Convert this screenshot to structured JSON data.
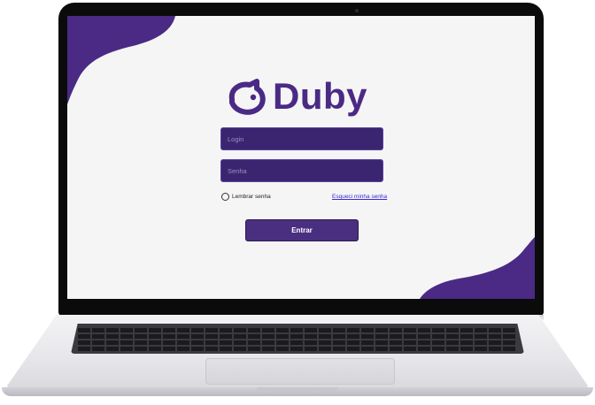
{
  "app": {
    "brand": "Duby",
    "accent_color": "#4a2a85",
    "field_color": "#3b2570"
  },
  "login_form": {
    "login_placeholder": "Login",
    "password_placeholder": "Senha",
    "remember_label": "Lembrar senha",
    "forgot_link": "Esqueci minha senha",
    "submit_label": "Entrar"
  },
  "icons": {
    "logo": "duby-logo-icon",
    "checkbox": "radio-checkbox-icon",
    "camera": "webcam-icon"
  }
}
